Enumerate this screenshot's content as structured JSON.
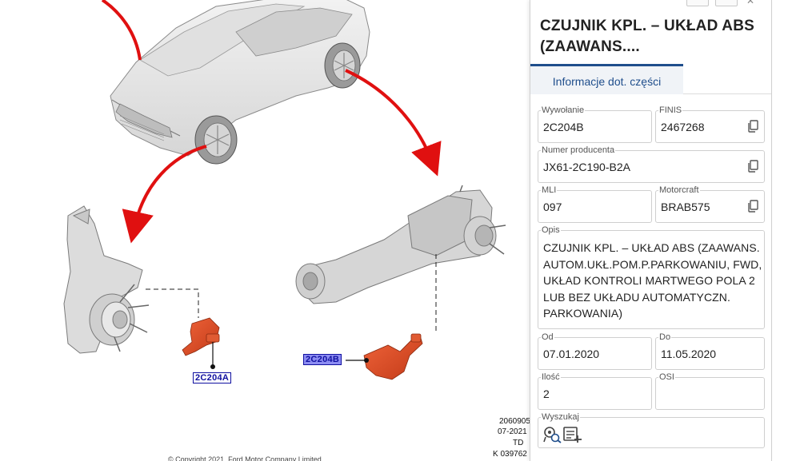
{
  "diagram": {
    "callouts": {
      "front": "2C204A",
      "rear": "2C204B"
    },
    "stamp_lines": [
      "2060905",
      "07-2021",
      "TD",
      "K 039762"
    ],
    "copyright": "© Copyright 2021, Ford Motor Company Limited"
  },
  "panel": {
    "title": "CZUJNIK KPL. – UKŁAD ABS (ZAAWANS....",
    "tab_label": "Informacje dot. części",
    "fields": {
      "wywolanie": {
        "label": "Wywołanie",
        "value": "2C204B"
      },
      "finis": {
        "label": "FINIS",
        "value": "2467268"
      },
      "numer_producenta": {
        "label": "Numer producenta",
        "value": "JX61-2C190-B2A"
      },
      "mli": {
        "label": "MLI",
        "value": "097"
      },
      "motorcraft": {
        "label": "Motorcraft",
        "value": "BRAB575"
      },
      "opis": {
        "label": "Opis",
        "value": "CZUJNIK KPL. – UKŁAD ABS (ZAAWANS. AUTOM.UKŁ.POM.P.PARKOWANIU, FWD, UKŁAD KONTROLI MARTWEGO POLA 2 LUB BEZ UKŁADU AUTOMATYCZN. PARKOWANIA)"
      },
      "od": {
        "label": "Od",
        "value": "07.01.2020"
      },
      "do": {
        "label": "Do",
        "value": "11.05.2020"
      },
      "ilosc": {
        "label": "Ilość",
        "value": "2"
      },
      "osi": {
        "label": "OSI",
        "value": ""
      },
      "wyszukaj": {
        "label": "Wyszukaj"
      }
    },
    "icons": {
      "copy": "copy-icon",
      "search_vin": "wheel-search-icon",
      "search_list": "list-add-icon",
      "close": "close-icon"
    },
    "colors": {
      "accent": "#1f4e8c",
      "part": "#e5502b",
      "arrow": "#e01010"
    }
  }
}
